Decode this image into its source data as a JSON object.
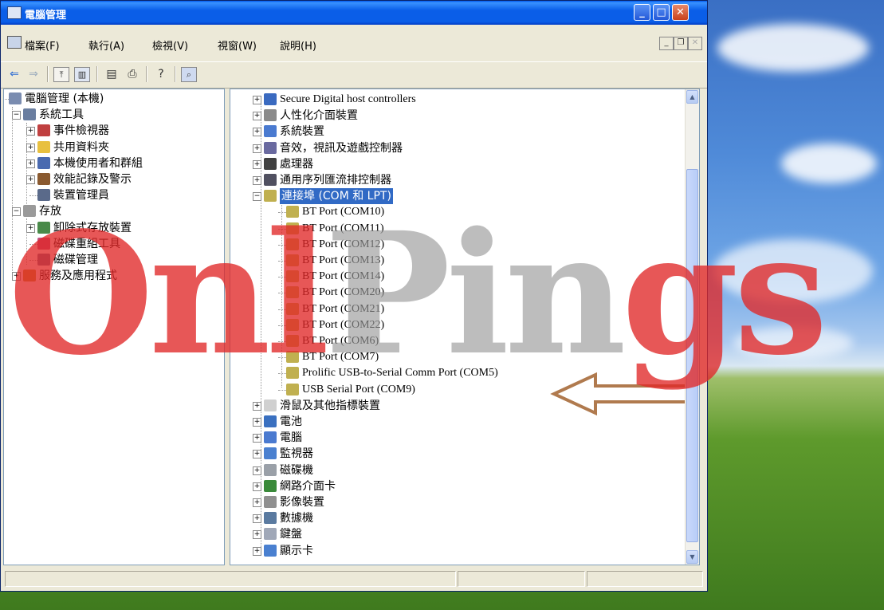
{
  "window": {
    "title": "電腦管理",
    "controls": {
      "minimize": "_",
      "maximize": "□",
      "close": "✕"
    }
  },
  "menubar": {
    "items": [
      "檔案(F)",
      "執行(A)",
      "檢視(V)",
      "視窗(W)",
      "說明(H)"
    ]
  },
  "left_tree": [
    {
      "label": "電腦管理 (本機)",
      "level": 0,
      "icon": "computer-management-icon",
      "expander": ""
    },
    {
      "label": "系統工具",
      "level": 1,
      "icon": "system-tools-icon",
      "expander": "−"
    },
    {
      "label": "事件檢視器",
      "level": 2,
      "icon": "event-viewer-icon",
      "expander": "+"
    },
    {
      "label": "共用資料夾",
      "level": 2,
      "icon": "shared-folders-icon",
      "expander": "+"
    },
    {
      "label": "本機使用者和群組",
      "level": 2,
      "icon": "users-groups-icon",
      "expander": "+"
    },
    {
      "label": "效能記錄及警示",
      "level": 2,
      "icon": "performance-icon",
      "expander": "+"
    },
    {
      "label": "裝置管理員",
      "level": 2,
      "icon": "device-manager-icon",
      "expander": ""
    },
    {
      "label": "存放",
      "level": 1,
      "icon": "storage-icon",
      "expander": "−"
    },
    {
      "label": "卸除式存放裝置",
      "level": 2,
      "icon": "removable-storage-icon",
      "expander": "+"
    },
    {
      "label": "磁碟重組工具",
      "level": 2,
      "icon": "defragmenter-icon",
      "expander": ""
    },
    {
      "label": "磁碟管理",
      "level": 2,
      "icon": "disk-management-icon",
      "expander": ""
    },
    {
      "label": "服務及應用程式",
      "level": 1,
      "icon": "services-icon",
      "expander": "+"
    }
  ],
  "device_tree": [
    {
      "label": "Secure Digital host controllers",
      "level": 0,
      "icon": "sd-controller-icon",
      "expander": "+",
      "serif": true
    },
    {
      "label": "人性化介面裝置",
      "level": 0,
      "icon": "hid-icon",
      "expander": "+"
    },
    {
      "label": "系統裝置",
      "level": 0,
      "icon": "system-devices-icon",
      "expander": "+"
    },
    {
      "label": "音效，視訊及遊戲控制器",
      "level": 0,
      "icon": "sound-video-icon",
      "expander": "+"
    },
    {
      "label": "處理器",
      "level": 0,
      "icon": "processor-icon",
      "expander": "+"
    },
    {
      "label": "通用序列匯流排控制器",
      "level": 0,
      "icon": "usb-controller-icon",
      "expander": "+"
    },
    {
      "label": "連接埠 (COM 和 LPT)",
      "level": 0,
      "icon": "port-icon",
      "expander": "−",
      "selected": true
    },
    {
      "label": "BT Port (COM10)",
      "level": 1,
      "icon": "port-icon",
      "serif": true
    },
    {
      "label": "BT Port (COM11)",
      "level": 1,
      "icon": "port-icon",
      "serif": true
    },
    {
      "label": "BT Port (COM12)",
      "level": 1,
      "icon": "port-icon",
      "serif": true
    },
    {
      "label": "BT Port (COM13)",
      "level": 1,
      "icon": "port-icon",
      "serif": true
    },
    {
      "label": "BT Port (COM14)",
      "level": 1,
      "icon": "port-icon",
      "serif": true
    },
    {
      "label": "BT Port (COM20)",
      "level": 1,
      "icon": "port-icon",
      "serif": true
    },
    {
      "label": "BT Port (COM21)",
      "level": 1,
      "icon": "port-icon",
      "serif": true
    },
    {
      "label": "BT Port (COM22)",
      "level": 1,
      "icon": "port-icon",
      "serif": true
    },
    {
      "label": "BT Port (COM6)",
      "level": 1,
      "icon": "port-icon",
      "serif": true
    },
    {
      "label": "BT Port (COM7)",
      "level": 1,
      "icon": "port-icon",
      "serif": true
    },
    {
      "label": "Prolific USB-to-Serial Comm Port (COM5)",
      "level": 1,
      "icon": "port-icon",
      "serif": true
    },
    {
      "label": "USB Serial Port (COM9)",
      "level": 1,
      "icon": "port-icon",
      "serif": true
    },
    {
      "label": "滑鼠及其他指標裝置",
      "level": 0,
      "icon": "mouse-icon",
      "expander": "+"
    },
    {
      "label": "電池",
      "level": 0,
      "icon": "battery-icon",
      "expander": "+"
    },
    {
      "label": "電腦",
      "level": 0,
      "icon": "computer-icon",
      "expander": "+"
    },
    {
      "label": "監視器",
      "level": 0,
      "icon": "monitor-icon",
      "expander": "+"
    },
    {
      "label": "磁碟機",
      "level": 0,
      "icon": "disk-drive-icon",
      "expander": "+"
    },
    {
      "label": "網路介面卡",
      "level": 0,
      "icon": "network-adapter-icon",
      "expander": "+"
    },
    {
      "label": "影像裝置",
      "level": 0,
      "icon": "imaging-device-icon",
      "expander": "+"
    },
    {
      "label": "數據機",
      "level": 0,
      "icon": "modem-icon",
      "expander": "+"
    },
    {
      "label": "鍵盤",
      "level": 0,
      "icon": "keyboard-icon",
      "expander": "+"
    },
    {
      "label": "顯示卡",
      "level": 0,
      "icon": "display-adapter-icon",
      "expander": "+"
    }
  ],
  "watermark": {
    "text_red": "Onl",
    "text_gray": "Pin",
    "text_red2": "gs"
  },
  "colors": {
    "selection": "#316ac5",
    "arrow": "#b07a4e",
    "watermark_red": "#e02828",
    "watermark_gray": "#9a9a9a"
  }
}
